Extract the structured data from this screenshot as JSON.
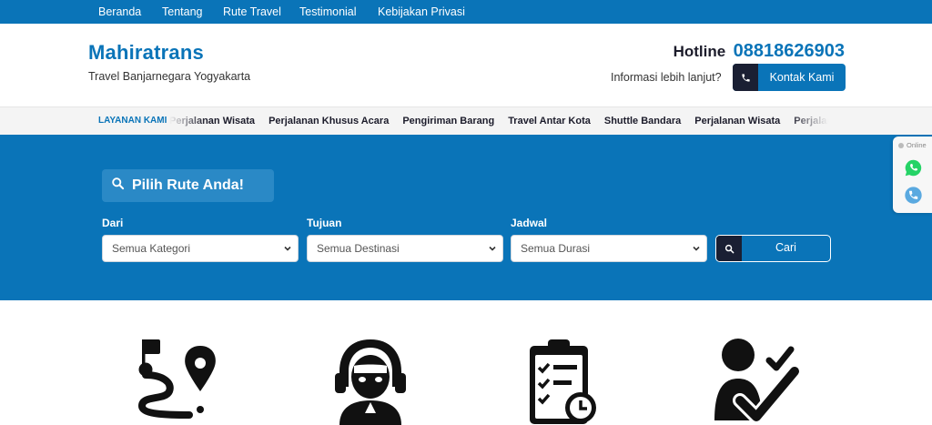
{
  "topnav": [
    "Beranda",
    "Tentang",
    "Rute Travel",
    "Testimonial",
    "Kebijakan Privasi"
  ],
  "header": {
    "brand": "Mahiratrans",
    "tagline": "Travel Banjarnegara Yogyakarta",
    "hotline_label": "Hotline",
    "hotline_number": "08818626903",
    "info_text": "Informasi lebih lanjut?",
    "contact_button": "Kontak Kami"
  },
  "services": {
    "title": "LAYANAN KAMI",
    "items": [
      "Perjalanan Wisata",
      "Perjalanan Khusus Acara",
      "Pengiriman Barang",
      "Travel Antar Kota",
      "Shuttle Bandara",
      "Perjalanan Wisata",
      "Perjalanan Khusus Acara"
    ]
  },
  "search": {
    "heading": "Pilih Rute Anda!",
    "from_label": "Dari",
    "from_value": "Semua Kategori",
    "to_label": "Tujuan",
    "to_value": "Semua Destinasi",
    "schedule_label": "Jadwal",
    "schedule_value": "Semua Durasi",
    "button": "Cari"
  },
  "floating": {
    "status": "Online",
    "icons": [
      "whatsapp-icon",
      "phone-icon"
    ]
  },
  "features": {
    "icons": [
      "route-map-icon",
      "customer-support-icon",
      "schedule-checklist-icon",
      "verified-person-icon"
    ]
  },
  "colors": {
    "primary": "#0a74b8",
    "dark": "#1a1f33",
    "whatsapp": "#25d366",
    "phone": "#5aa9e0"
  }
}
